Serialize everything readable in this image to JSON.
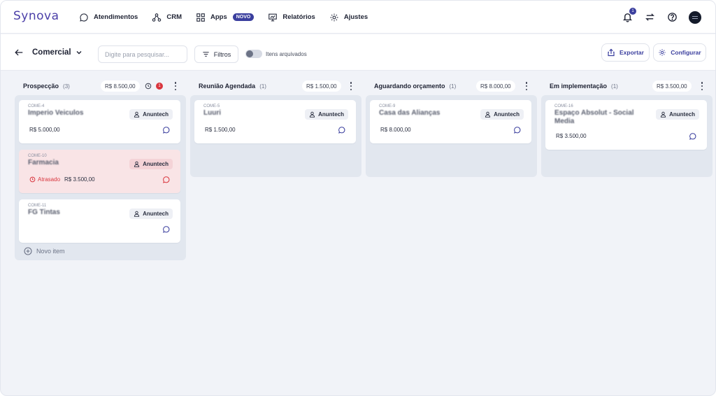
{
  "app": {
    "logo": "Synova"
  },
  "nav": {
    "items": [
      {
        "label": "Atendimentos",
        "icon": "chat-bubble-icon"
      },
      {
        "label": "CRM",
        "icon": "crm-nodes-icon"
      },
      {
        "label": "Apps",
        "icon": "apps-grid-icon",
        "badge": "NOVO"
      },
      {
        "label": "Relatórios",
        "icon": "report-chart-icon"
      },
      {
        "label": "Ajustes",
        "icon": "gear-icon"
      }
    ],
    "notifications_count": "1",
    "right_icons": [
      "bell-icon",
      "switch-arrows-icon",
      "help-icon",
      "avatar"
    ]
  },
  "toolbar": {
    "pipeline_name": "Comercial",
    "search_placeholder": "Digite para pesquisar...",
    "filter_label": "Filtros",
    "archived_label": "Itens arquivados",
    "export_label": "Exportar",
    "configure_label": "Configurar"
  },
  "colors": {
    "brand": "#3b3f9e",
    "late_bg": "#f9e4e6",
    "late_text": "#d9363e",
    "column_bg": "#e2e7ef"
  },
  "columns": [
    {
      "title": "Prospecção",
      "count": "(3)",
      "total": "R$ 8.500,00",
      "overdue_count": "1",
      "new_item_label": "Novo item",
      "cards": [
        {
          "code": "COME-4",
          "name": "Imperio Veiculos",
          "owner": "Anuntech",
          "value": "R$ 5.000,00"
        },
        {
          "code": "COME-10",
          "name": "Farmacia",
          "owner": "Anuntech",
          "value": "R$ 3.500,00",
          "late_label": "Atrasado"
        },
        {
          "code": "COME-11",
          "name": "FG Tintas",
          "owner": "Anuntech",
          "value": ""
        }
      ]
    },
    {
      "title": "Reunião Agendada",
      "count": "(1)",
      "total": "R$ 1.500,00",
      "cards": [
        {
          "code": "COME-5",
          "name": "Luuri",
          "owner": "Anuntech",
          "value": "R$ 1.500,00"
        }
      ]
    },
    {
      "title": "Aguardando orçamento",
      "count": "(1)",
      "total": "R$ 8.000,00",
      "cards": [
        {
          "code": "COME-9",
          "name": "Casa das Alianças",
          "owner": "Anuntech",
          "value": "R$ 8.000,00"
        }
      ]
    },
    {
      "title": "Em implementação",
      "count": "(1)",
      "total": "R$ 3.500,00",
      "cards": [
        {
          "code": "COME-16",
          "name": "Espaço Absolut - Social Media",
          "owner": "Anuntech",
          "value": "R$ 3.500,00"
        }
      ]
    }
  ]
}
